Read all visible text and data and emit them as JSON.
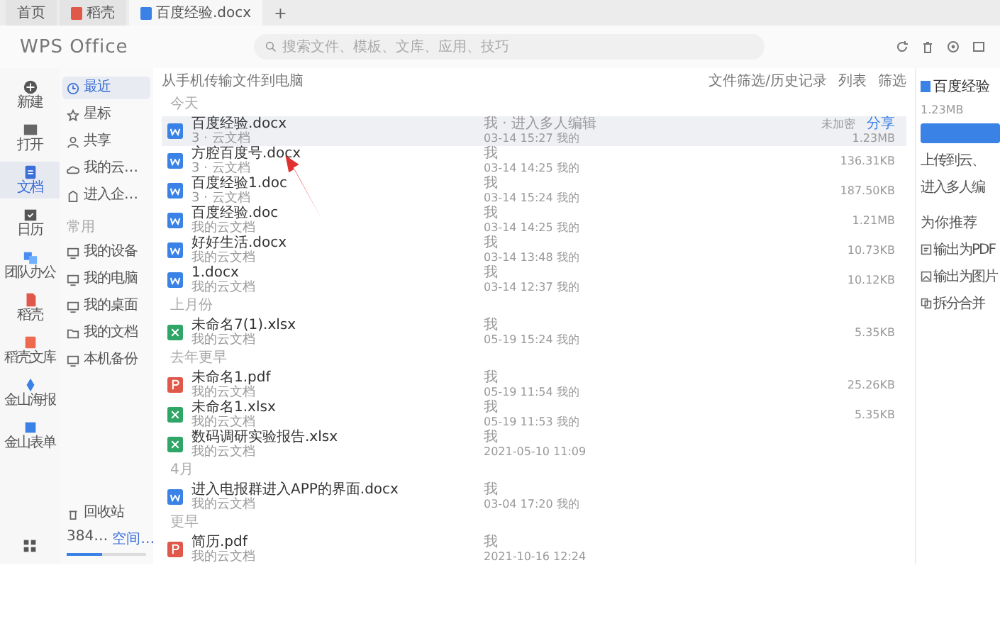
{
  "tabs": [
    {
      "label": "首页",
      "kind": "home",
      "selected": false
    },
    {
      "label": "稻壳",
      "kind": "docer",
      "selected": false
    },
    {
      "label": "百度经验.docx",
      "kind": "word",
      "selected": true
    }
  ],
  "new_tab": "+",
  "header": {
    "logo": "WPS Office",
    "search": {
      "placeholder": "搜索文件、模板、文库、应用、技巧"
    }
  },
  "rail": [
    {
      "label": "新建",
      "kind": "new",
      "selected": false
    },
    {
      "label": "打开",
      "kind": "open",
      "selected": false
    },
    {
      "label": "文档",
      "kind": "doc",
      "selected": true
    },
    {
      "label": "日历",
      "kind": "calendar",
      "selected": false
    },
    {
      "label": "团队办公",
      "kind": "team",
      "selected": false
    },
    {
      "label": "稻壳",
      "kind": "docer",
      "selected": false
    },
    {
      "label": "稻壳文库",
      "kind": "library",
      "selected": false
    },
    {
      "label": "金山海报",
      "kind": "poster",
      "selected": false
    },
    {
      "label": "金山表单",
      "kind": "form",
      "selected": false
    }
  ],
  "nav": [
    {
      "label": "最近",
      "kind": "clock",
      "selected": true
    },
    {
      "label": "星标",
      "kind": "star",
      "selected": false
    },
    {
      "label": "共享",
      "kind": "share",
      "selected": false
    },
    {
      "label": "我的云…",
      "kind": "cloud",
      "selected": false
    },
    {
      "label": "进入企…",
      "kind": "company",
      "selected": false
    }
  ],
  "nav_section": "常用",
  "nav_devices": [
    {
      "label": "我的设备",
      "kind": "device"
    },
    {
      "label": "我的电脑",
      "kind": "pc"
    },
    {
      "label": "我的桌面",
      "kind": "desktop"
    },
    {
      "label": "我的文档",
      "kind": "folder"
    },
    {
      "label": "本机备份",
      "kind": "backup"
    }
  ],
  "recycle": "回收站",
  "storage": {
    "used": "384…",
    "link": "空间…",
    "level": 0.45
  },
  "toolbar": {
    "transfer": "从手机传输文件到电脑",
    "filter_tool": "文件筛选/历史记录",
    "list": "列表",
    "filter": "筛选"
  },
  "groups": [
    {
      "label": "今天",
      "files": [
        {
          "kind": "word",
          "name": "百度经验.docx",
          "location": "3 · 云文档",
          "owner": "我 · 进入多人编辑",
          "time": "03-14 15:27 我的",
          "size": "1.23MB",
          "selected": true,
          "status": "未加密",
          "share": "分享"
        },
        {
          "kind": "word",
          "name": "方腔百度号.docx",
          "location": "3 · 云文档",
          "owner": "我",
          "time": "03-14 14:25 我的",
          "size": "136.31KB",
          "selected": false
        },
        {
          "kind": "word",
          "name": "百度经验1.doc",
          "location": "3 · 云文档",
          "owner": "我",
          "time": "03-14 15:24 我的",
          "size": "187.50KB",
          "selected": false
        },
        {
          "kind": "word",
          "name": "百度经验.doc",
          "location": "我的云文档",
          "owner": "我",
          "time": "03-14 14:25 我的",
          "size": "1.21MB",
          "selected": false
        },
        {
          "kind": "word",
          "name": "好好生活.docx",
          "location": "我的云文档",
          "owner": "我",
          "time": "03-14 13:48 我的",
          "size": "10.73KB",
          "selected": false
        },
        {
          "kind": "word",
          "name": "1.docx",
          "location": "我的云文档",
          "owner": "我",
          "time": "03-14 12:37 我的",
          "size": "10.12KB",
          "selected": false
        }
      ]
    },
    {
      "label": "上月份",
      "files": [
        {
          "kind": "excel",
          "name": "未命名7(1).xlsx",
          "location": "我的云文档",
          "owner": "我",
          "time": "05-19 15:24 我的",
          "size": "5.35KB",
          "selected": false
        }
      ]
    },
    {
      "label": "去年更早",
      "files": [
        {
          "kind": "pdf",
          "name": "未命名1.pdf",
          "location": "我的云文档",
          "owner": "我",
          "time": "05-19 11:54 我的",
          "size": "25.26KB",
          "selected": false
        },
        {
          "kind": "excel",
          "name": "未命名1.xlsx",
          "location": "我的云文档",
          "owner": "我",
          "time": "05-19 11:53 我的",
          "size": "5.35KB",
          "selected": false
        },
        {
          "kind": "excel",
          "name": "数码调研实验报告.xlsx",
          "location": "我的云文档",
          "owner": "我",
          "time": "2021-05-10 11:09",
          "selected": false
        }
      ]
    },
    {
      "label": "4月",
      "files": [
        {
          "kind": "word",
          "name": "进入电报群进入APP的界面.docx",
          "location": "我的云文档",
          "owner": "我",
          "time": "03-04 17:20 我的",
          "selected": false
        }
      ]
    },
    {
      "label": "更早",
      "files": [
        {
          "kind": "pdf",
          "name": "简历.pdf",
          "location": "我的云文档",
          "owner": "我",
          "time": "2021-10-16 12:24",
          "selected": false
        }
      ]
    }
  ],
  "panel": {
    "title": "百度经验",
    "size": "1.23MB",
    "actions": [
      "上传到云、",
      "进入多人编"
    ],
    "recommend": "为你推荐",
    "tools": [
      {
        "label": "输出为PDF",
        "kind": "pdf"
      },
      {
        "label": "输出为图片",
        "kind": "image"
      },
      {
        "label": "拆分合并",
        "kind": "split"
      }
    ]
  }
}
